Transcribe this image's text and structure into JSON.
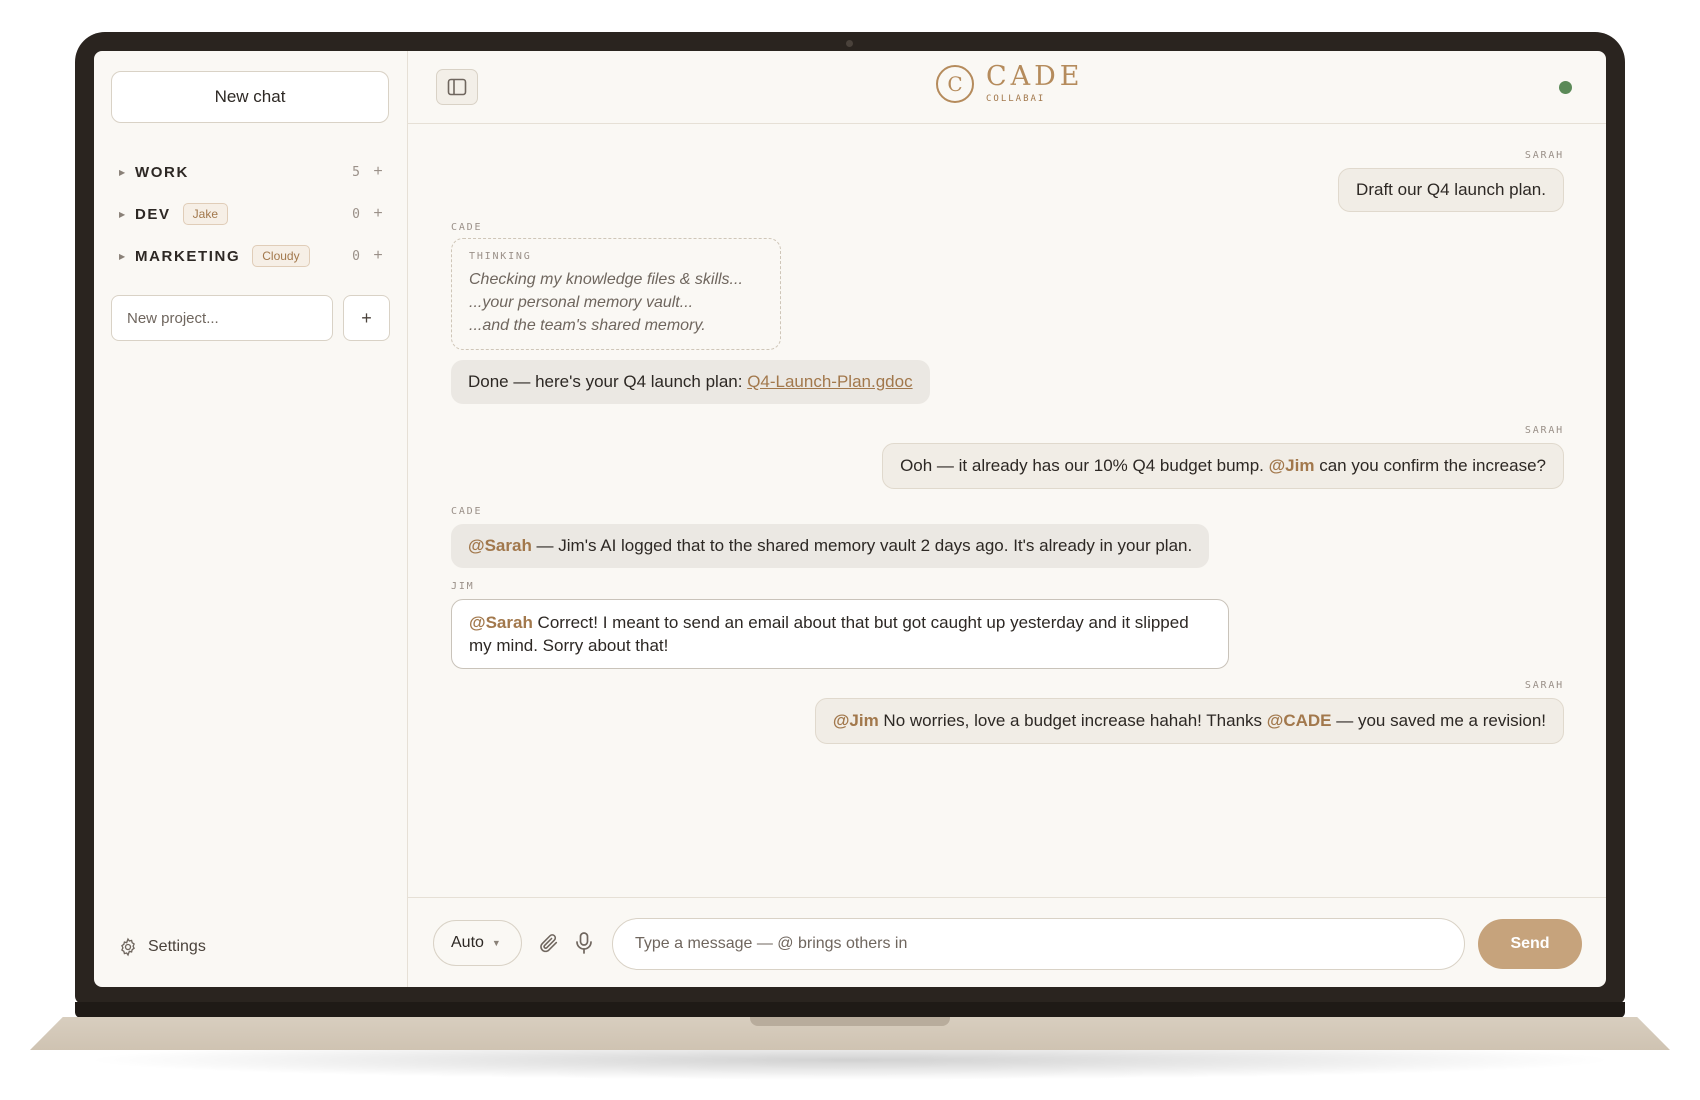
{
  "sidebar": {
    "new_chat_label": "New chat",
    "projects": [
      {
        "name": "WORK",
        "tag": "",
        "count": "5"
      },
      {
        "name": "DEV",
        "tag": "Jake",
        "count": "0"
      },
      {
        "name": "MARKETING",
        "tag": "Cloudy",
        "count": "0"
      }
    ],
    "new_project_placeholder": "New project...",
    "add_project_label": "+",
    "add_label": "+",
    "settings_label": "Settings"
  },
  "header": {
    "brand_letter": "C",
    "brand_title": "CADE",
    "brand_subtitle": "COLLABAI",
    "status_color": "#5b8a58"
  },
  "messages": [
    {
      "sender": "SARAH",
      "text": "Draft our Q4 launch plan."
    },
    {
      "sender": "CADE",
      "thinking_label": "THINKING",
      "thinking_lines": [
        "Checking my knowledge files & skills...",
        "...your personal memory vault...",
        "...and the team's shared memory."
      ],
      "text": "Done — here's your Q4 launch plan: ",
      "link": "Q4-Launch-Plan.gdoc"
    },
    {
      "sender": "SARAH",
      "pre": "Ooh — it already has our 10% Q4 budget bump. ",
      "mention": "@Jim",
      "post": " can you confirm the increase?"
    },
    {
      "sender": "CADE",
      "mention": "@Sarah",
      "post": " — Jim's AI logged that to the shared memory vault 2 days ago. It's already in your plan."
    },
    {
      "sender": "JIM",
      "mention": "@Sarah",
      "post": " Correct! I meant to send an email about that but got caught up yesterday and it slipped my mind. Sorry about that!"
    },
    {
      "sender": "SARAH",
      "mention1": "@Jim",
      "mid": " No worries, love a budget increase hahah! Thanks ",
      "mention2": "@CADE",
      "post": " — you saved me a revision!"
    }
  ],
  "composer": {
    "mode_label": "Auto",
    "placeholder": "Type a message — @ brings others in",
    "send_label": "Send"
  },
  "colors": {
    "accent": "#c6a37c",
    "brand": "#b58b5c",
    "mention": "#a2784c"
  }
}
